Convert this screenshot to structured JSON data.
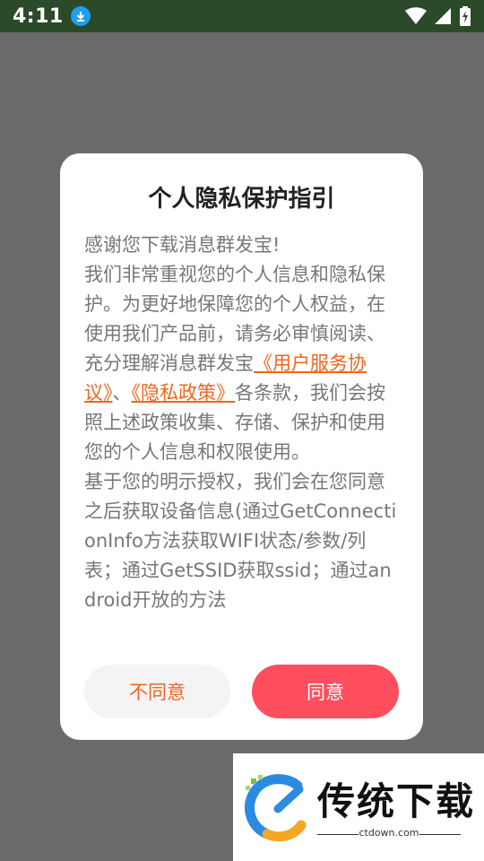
{
  "status_bar": {
    "time": "4:11",
    "icons": [
      "download-icon",
      "wifi-icon",
      "signal-icon",
      "battery-charging-icon"
    ]
  },
  "dialog": {
    "title": "个人隐私保护指引",
    "body": {
      "p1": "感谢您下载消息群发宝!",
      "p2_before": "我们非常重视您的个人信息和隐私保护。为更好地保障您的个人权益，在使用我们产品前，请务必审慎阅读、充分理解消息群发宝",
      "link_user_agreement": "《用户服务协议》",
      "sep": "、",
      "link_privacy_policy": "《隐私政策》",
      "p2_after": "各条款，我们会按照上述政策收集、存储、保护和使用您的个人信息和权限使用。",
      "p3": "基于您的明示授权，我们会在您同意之后获取设备信息(通过GetConnectionInfo方法获取WIFI状态/参数/列表；通过GetSSID获取ssid；通过android开放的方法"
    },
    "disagree_label": "不同意",
    "agree_label": "同意"
  },
  "watermark": {
    "brand": "传统下载",
    "url": "ctdown.com"
  },
  "colors": {
    "accent_orange": "#f0661e",
    "agree_red": "#ff4f5e",
    "overlay": "#6b6b6b",
    "status_bar": "#2a4a2a"
  }
}
